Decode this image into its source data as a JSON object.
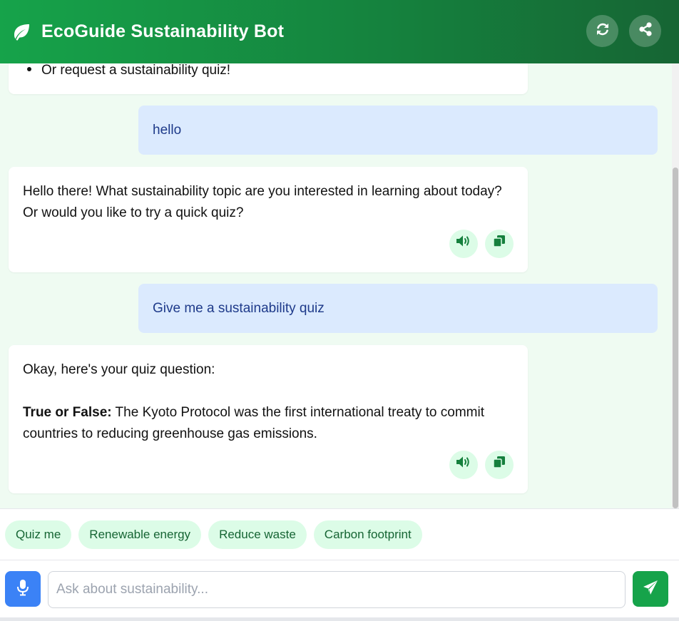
{
  "header": {
    "title": "EcoGuide Sustainability Bot",
    "icons": {
      "logo": "leaf-icon",
      "refresh": "refresh-icon",
      "share": "share-icon"
    }
  },
  "messages": [
    {
      "role": "bot",
      "text": "Or request a sustainability quiz!"
    },
    {
      "role": "user",
      "text": "hello"
    },
    {
      "role": "bot",
      "text": "Hello there! What sustainability topic are you interested in learning about today? Or would you like to try a quick quiz?"
    },
    {
      "role": "user",
      "text": "Give me a sustainability quiz"
    },
    {
      "role": "bot",
      "intro": "Okay, here's your quiz question:",
      "bold_label": "True or False:",
      "text": " The Kyoto Protocol was the first international treaty to commit countries to reducing greenhouse gas emissions."
    }
  ],
  "message_actions": {
    "speak": "volume-icon",
    "copy": "copy-icon"
  },
  "suggestions": [
    "Quiz me",
    "Renewable energy",
    "Reduce waste",
    "Carbon footprint"
  ],
  "input": {
    "placeholder": "Ask about sustainability...",
    "value": ""
  },
  "colors": {
    "brand": "#16a34a",
    "user_bubble": "#dbeafe",
    "chip": "#dcfce7",
    "mic": "#3b82f6"
  }
}
